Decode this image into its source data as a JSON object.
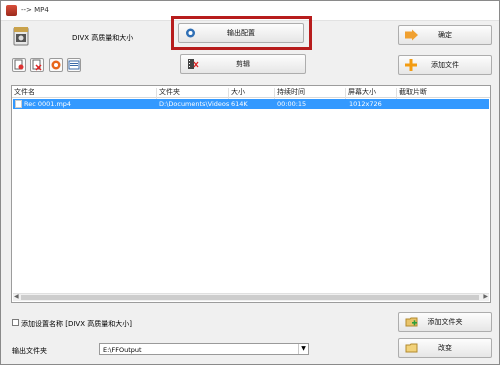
{
  "window": {
    "title": "--> MP4"
  },
  "profile": {
    "label": "DIVX 高质量和大小"
  },
  "buttons": {
    "output_settings": "输出配置",
    "ok": "确定",
    "clip": "剪辑",
    "add_file": "添加文件",
    "add_folder": "添加文件夹",
    "change": "改变"
  },
  "file_list": {
    "columns": [
      "文件名",
      "文件夹",
      "大小",
      "持续时间",
      "屏幕大小",
      "截取片断"
    ],
    "rows": [
      {
        "name": "Rec 0001.mp4",
        "folder": "D:\\Documents\\Videos",
        "size": "614K",
        "duration": "00:00:15",
        "screen": "1012x726",
        "clip": ""
      }
    ]
  },
  "options": {
    "add_setting_name_label": "添加设置名称 [DIVX 高质量和大小]",
    "add_setting_name_checked": false
  },
  "output": {
    "folder_label": "输出文件夹",
    "folder_value": "E:\\FFOutput"
  },
  "colors": {
    "selection": "#3399ff",
    "highlight_border": "#b71c1c",
    "add_icon": "#f39c12"
  }
}
